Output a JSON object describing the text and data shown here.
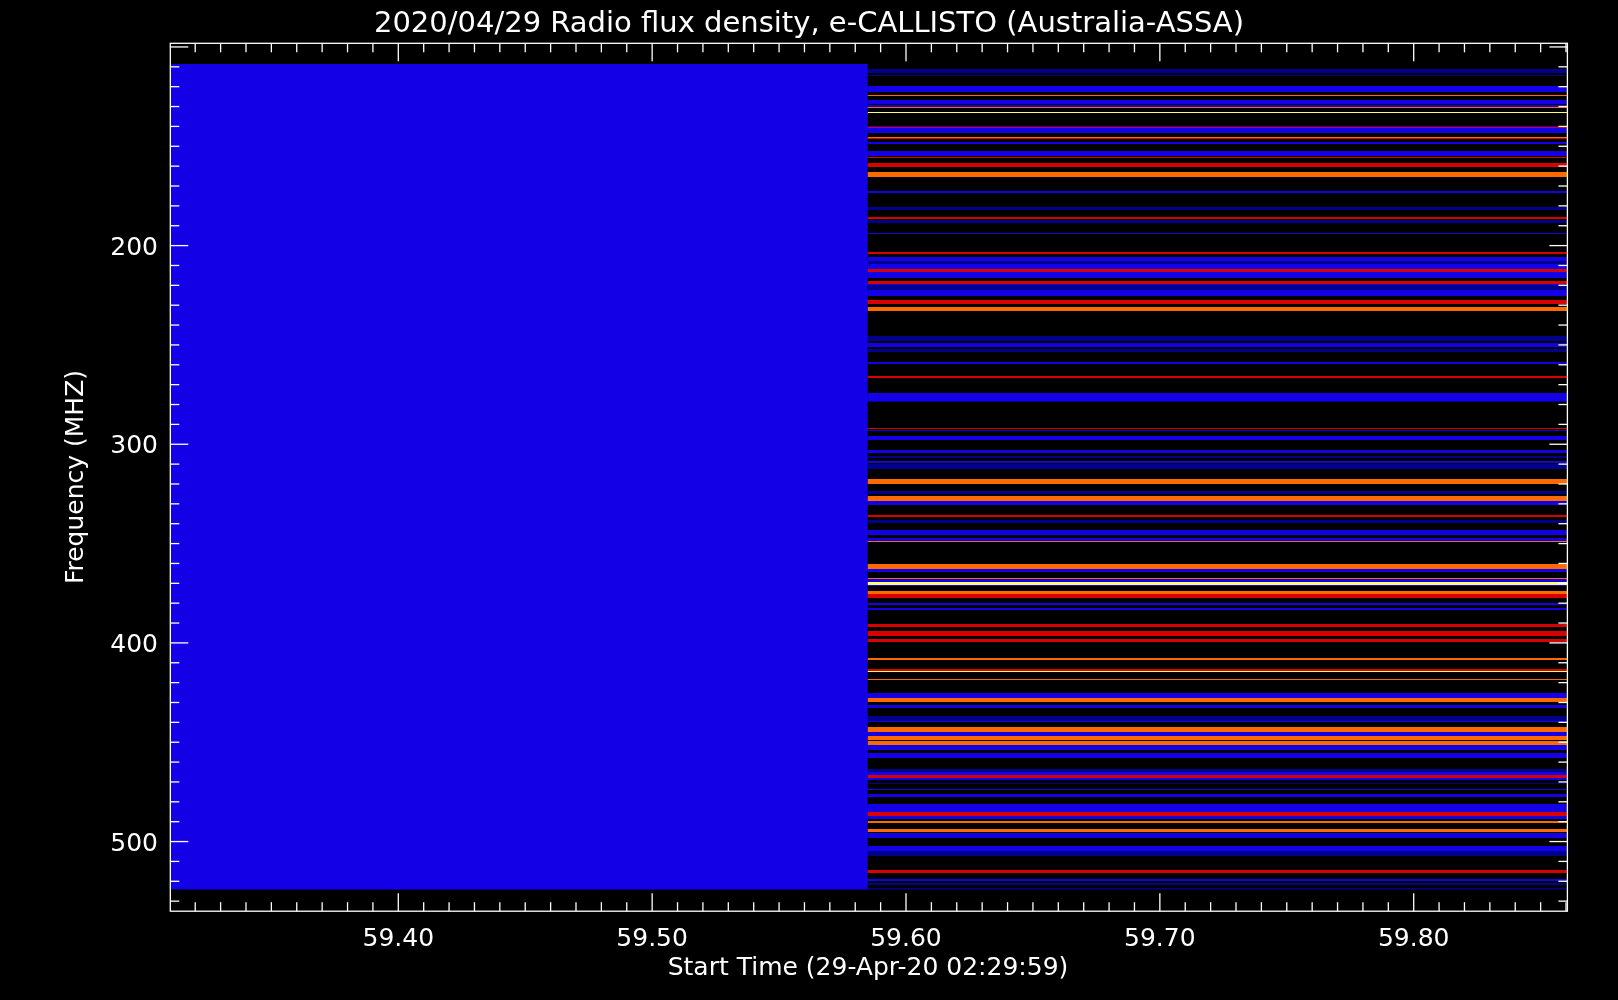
{
  "title": "2020/04/29  Radio flux density, e-CALLISTO (Australia-ASSA)",
  "y_axis": {
    "label": "Frequency (MHZ)",
    "ticks": [
      "200",
      "300",
      "400",
      "500"
    ]
  },
  "x_axis": {
    "label": "Start Time (29-Apr-20 02:29:59)",
    "ticks": [
      "59.40",
      "59.50",
      "59.60",
      "59.70",
      "59.80"
    ]
  }
}
